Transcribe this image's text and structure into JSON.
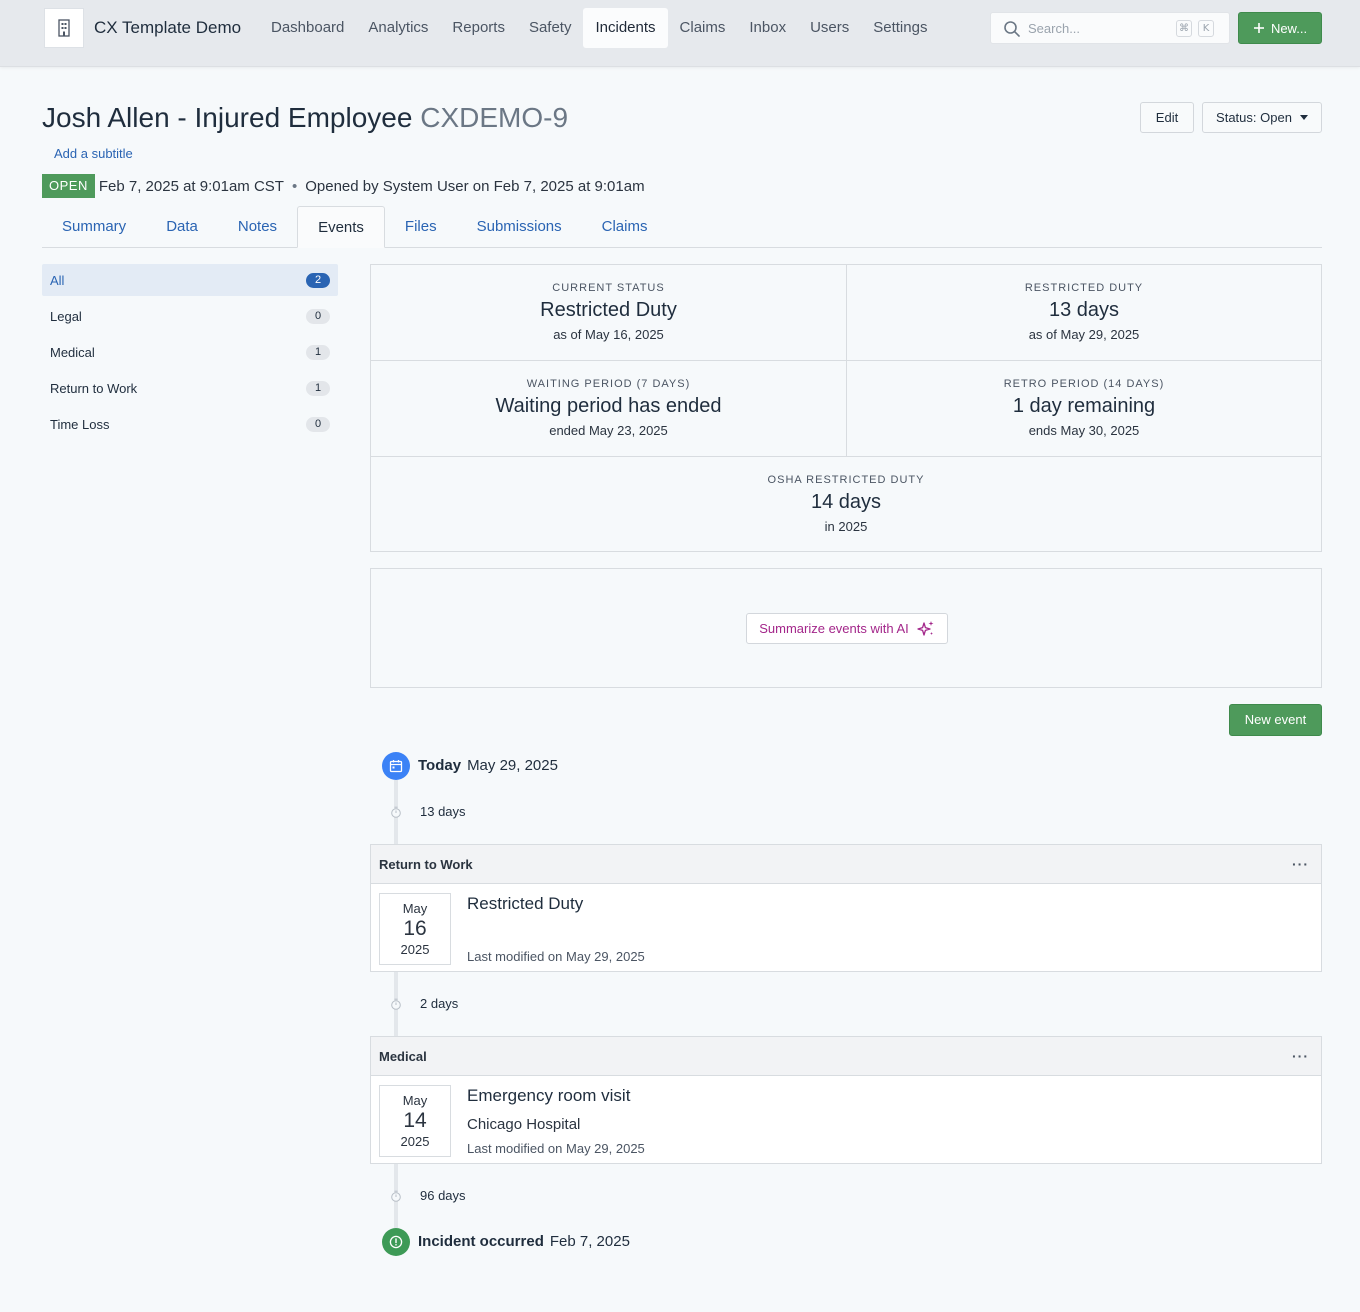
{
  "app": {
    "title": "CX Template Demo",
    "logo_icon": "building-icon"
  },
  "nav": {
    "items": [
      "Dashboard",
      "Analytics",
      "Reports",
      "Safety",
      "Incidents",
      "Claims",
      "Inbox",
      "Users",
      "Settings"
    ],
    "active": "Incidents"
  },
  "search": {
    "placeholder": "Search...",
    "key1": "⌘",
    "key2": "K"
  },
  "new_button": "New...",
  "incident": {
    "title": "Josh Allen - Injured Employee",
    "code": "CXDEMO-9",
    "subtitle_link": "Add a subtitle",
    "status_badge": "OPEN",
    "date": "Feb 7, 2025 at 9:01am CST",
    "separator": "•",
    "opened_by": "Opened by System User on Feb 7, 2025 at 9:01am"
  },
  "actions": {
    "edit": "Edit",
    "status": "Status: Open"
  },
  "tabs": [
    "Summary",
    "Data",
    "Notes",
    "Events",
    "Files",
    "Submissions",
    "Claims"
  ],
  "active_tab": "Events",
  "filters": [
    {
      "label": "All",
      "count": "2"
    },
    {
      "label": "Legal",
      "count": "0"
    },
    {
      "label": "Medical",
      "count": "1"
    },
    {
      "label": "Return to Work",
      "count": "1"
    },
    {
      "label": "Time Loss",
      "count": "0"
    }
  ],
  "stats": {
    "current_status": {
      "label": "CURRENT STATUS",
      "value": "Restricted Duty",
      "sub": "as of May 16, 2025"
    },
    "restricted_duty": {
      "label": "RESTRICTED DUTY",
      "value": "13 days",
      "sub": "as of May 29, 2025"
    },
    "waiting_period": {
      "label": "WAITING PERIOD (7 DAYS)",
      "value": "Waiting period has ended",
      "sub": "ended May 23, 2025"
    },
    "retro_period": {
      "label": "RETRO PERIOD (14 DAYS)",
      "value": "1 day remaining",
      "sub": "ends May 30, 2025"
    },
    "osha": {
      "label": "OSHA RESTRICTED DUTY",
      "value": "14 days",
      "sub": "in 2025"
    }
  },
  "ai_button": "Summarize events with AI",
  "new_event_button": "New event",
  "timeline": {
    "today": {
      "label": "Today",
      "date": "May 29, 2025"
    },
    "gaps": [
      "13 days",
      "2 days",
      "96 days"
    ],
    "events": [
      {
        "category": "Return to Work",
        "month": "May",
        "day": "16",
        "year": "2025",
        "title": "Restricted Duty",
        "detail": "",
        "modified": "Last modified on May 29, 2025"
      },
      {
        "category": "Medical",
        "month": "May",
        "day": "14",
        "year": "2025",
        "title": "Emergency room visit",
        "detail": "Chicago Hospital",
        "modified": "Last modified on May 29, 2025"
      }
    ],
    "origin": {
      "label": "Incident occurred",
      "date": "Feb 7, 2025"
    }
  },
  "colors": {
    "primary_green": "#4e9a5b",
    "link_blue": "#2a64b3",
    "ai_magenta": "#a3268a",
    "today_blue": "#3b82f6",
    "origin_green": "#3d9a56"
  }
}
